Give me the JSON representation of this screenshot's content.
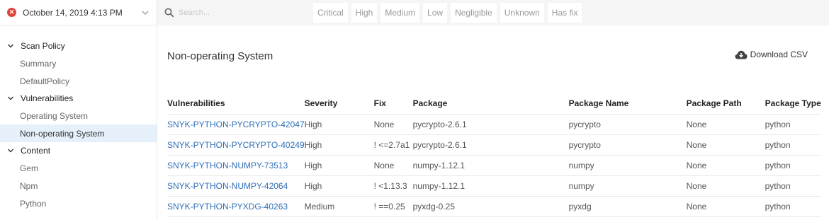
{
  "sidebar": {
    "header": {
      "date": "October 14, 2019 4:13 PM",
      "status_icon": "error-x-icon",
      "status_color": "#e0453d"
    },
    "groups": [
      {
        "label": "Scan Policy",
        "items": [
          {
            "label": "Summary"
          },
          {
            "label": "DefaultPolicy"
          }
        ]
      },
      {
        "label": "Vulnerabilities",
        "items": [
          {
            "label": "Operating System"
          },
          {
            "label": "Non-operating System",
            "active": true
          }
        ]
      },
      {
        "label": "Content",
        "items": [
          {
            "label": "Gem"
          },
          {
            "label": "Npm"
          },
          {
            "label": "Python"
          }
        ]
      }
    ]
  },
  "search": {
    "placeholder": "Search..."
  },
  "filters": [
    "Critical",
    "High",
    "Medium",
    "Low",
    "Negligible",
    "Unknown",
    "Has fix"
  ],
  "main": {
    "title": "Non-operating System",
    "download_label": "Download CSV"
  },
  "table": {
    "columns": [
      "Vulnerabilities",
      "Severity",
      "Fix",
      "Package",
      "Package Name",
      "Package Path",
      "Package Type"
    ],
    "rows": [
      [
        "SNYK-PYTHON-PYCRYPTO-42047",
        "High",
        "None",
        "pycrypto-2.6.1",
        "pycrypto",
        "None",
        "python"
      ],
      [
        "SNYK-PYTHON-PYCRYPTO-40249",
        "High",
        "! <=2.7a1",
        "pycrypto-2.6.1",
        "pycrypto",
        "None",
        "python"
      ],
      [
        "SNYK-PYTHON-NUMPY-73513",
        "High",
        "None",
        "numpy-1.12.1",
        "numpy",
        "None",
        "python"
      ],
      [
        "SNYK-PYTHON-NUMPY-42064",
        "High",
        "! <1.13.3",
        "numpy-1.12.1",
        "numpy",
        "None",
        "python"
      ],
      [
        "SNYK-PYTHON-PYXDG-40263",
        "Medium",
        "! ==0.25",
        "pyxdg-0.25",
        "pyxdg",
        "None",
        "python"
      ]
    ]
  },
  "colors": {
    "link": "#2f6fb8",
    "active_bg": "#e5f0fb",
    "topbar_bg": "#f5f5f5"
  }
}
